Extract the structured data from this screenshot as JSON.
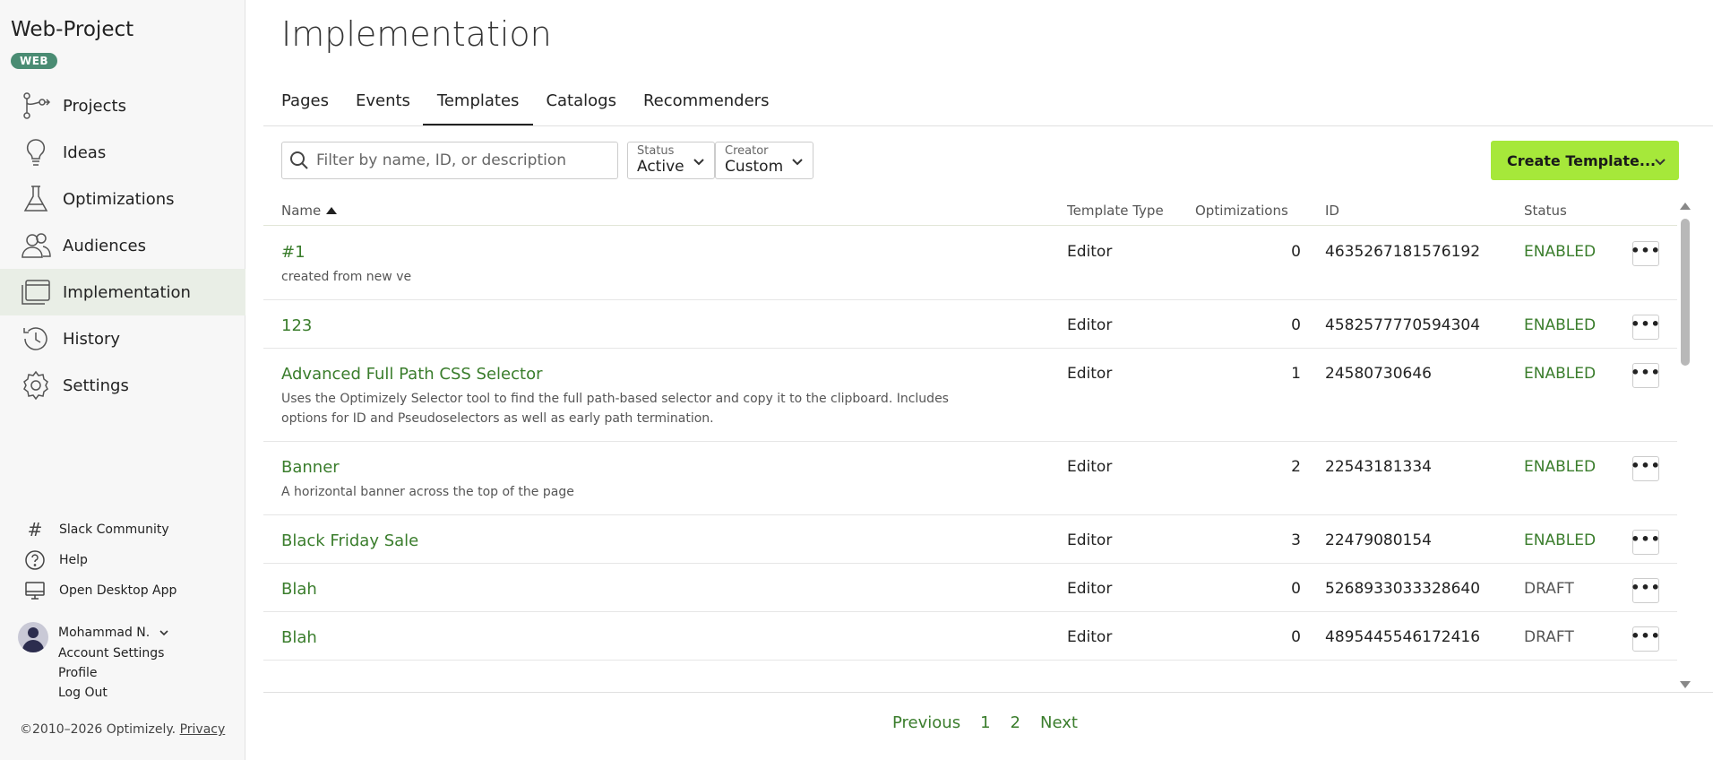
{
  "sidebar": {
    "project_name": "Web-Project",
    "badge": "WEB",
    "nav": [
      {
        "label": "Projects",
        "icon": "projects-icon",
        "active": false
      },
      {
        "label": "Ideas",
        "icon": "lightbulb-icon",
        "active": false
      },
      {
        "label": "Optimizations",
        "icon": "flask-icon",
        "active": false
      },
      {
        "label": "Audiences",
        "icon": "audiences-icon",
        "active": false
      },
      {
        "label": "Implementation",
        "icon": "implementation-icon",
        "active": true
      },
      {
        "label": "History",
        "icon": "history-icon",
        "active": false
      },
      {
        "label": "Settings",
        "icon": "gear-icon",
        "active": false
      }
    ],
    "utilities": [
      {
        "label": "Slack Community",
        "icon": "hash-icon"
      },
      {
        "label": "Help",
        "icon": "help-icon"
      },
      {
        "label": "Open Desktop App",
        "icon": "desktop-icon"
      }
    ],
    "user": {
      "name": "Mohammad N.",
      "links": [
        "Account Settings",
        "Profile",
        "Log Out"
      ]
    },
    "copyright": "©2010–2026 Optimizely.",
    "privacy": "Privacy"
  },
  "main": {
    "title": "Implementation",
    "tabs": [
      {
        "label": "Pages",
        "active": false
      },
      {
        "label": "Events",
        "active": false
      },
      {
        "label": "Templates",
        "active": true
      },
      {
        "label": "Catalogs",
        "active": false
      },
      {
        "label": "Recommenders",
        "active": false
      }
    ],
    "search_placeholder": "Filter by name, ID, or description",
    "status_filter": {
      "label": "Status",
      "value": "Active"
    },
    "creator_filter": {
      "label": "Creator",
      "value": "Custom"
    },
    "create_button": "Create Template...",
    "columns": {
      "name": "Name",
      "type": "Template Type",
      "optimizations": "Optimizations",
      "id": "ID",
      "status": "Status"
    },
    "rows": [
      {
        "name": "#1",
        "description": "created from new ve",
        "type": "Editor",
        "optimizations": "0",
        "id": "4635267181576192",
        "status": "ENABLED"
      },
      {
        "name": "123",
        "description": "",
        "type": "Editor",
        "optimizations": "0",
        "id": "4582577770594304",
        "status": "ENABLED"
      },
      {
        "name": "Advanced Full Path CSS Selector",
        "description": "Uses the Optimizely Selector tool to find the full path-based selector and copy it to the clipboard. Includes options for ID and Pseudoselectors as well as early path termination.",
        "type": "Editor",
        "optimizations": "1",
        "id": "24580730646",
        "status": "ENABLED"
      },
      {
        "name": "Banner",
        "description": "A horizontal banner across the top of the page",
        "type": "Editor",
        "optimizations": "2",
        "id": "22543181334",
        "status": "ENABLED"
      },
      {
        "name": "Black Friday Sale",
        "description": "",
        "type": "Editor",
        "optimizations": "3",
        "id": "22479080154",
        "status": "ENABLED"
      },
      {
        "name": "Blah",
        "description": "",
        "type": "Editor",
        "optimizations": "0",
        "id": "5268933033328640",
        "status": "DRAFT"
      },
      {
        "name": "Blah",
        "description": "",
        "type": "Editor",
        "optimizations": "0",
        "id": "4895445546172416",
        "status": "DRAFT"
      }
    ],
    "pager": {
      "previous": "Previous",
      "pages": [
        "1",
        "2"
      ],
      "next": "Next"
    },
    "colors": {
      "accent_green": "#3a7d2c",
      "button_lime": "#a6e83a",
      "badge": "#4a8c73"
    }
  }
}
